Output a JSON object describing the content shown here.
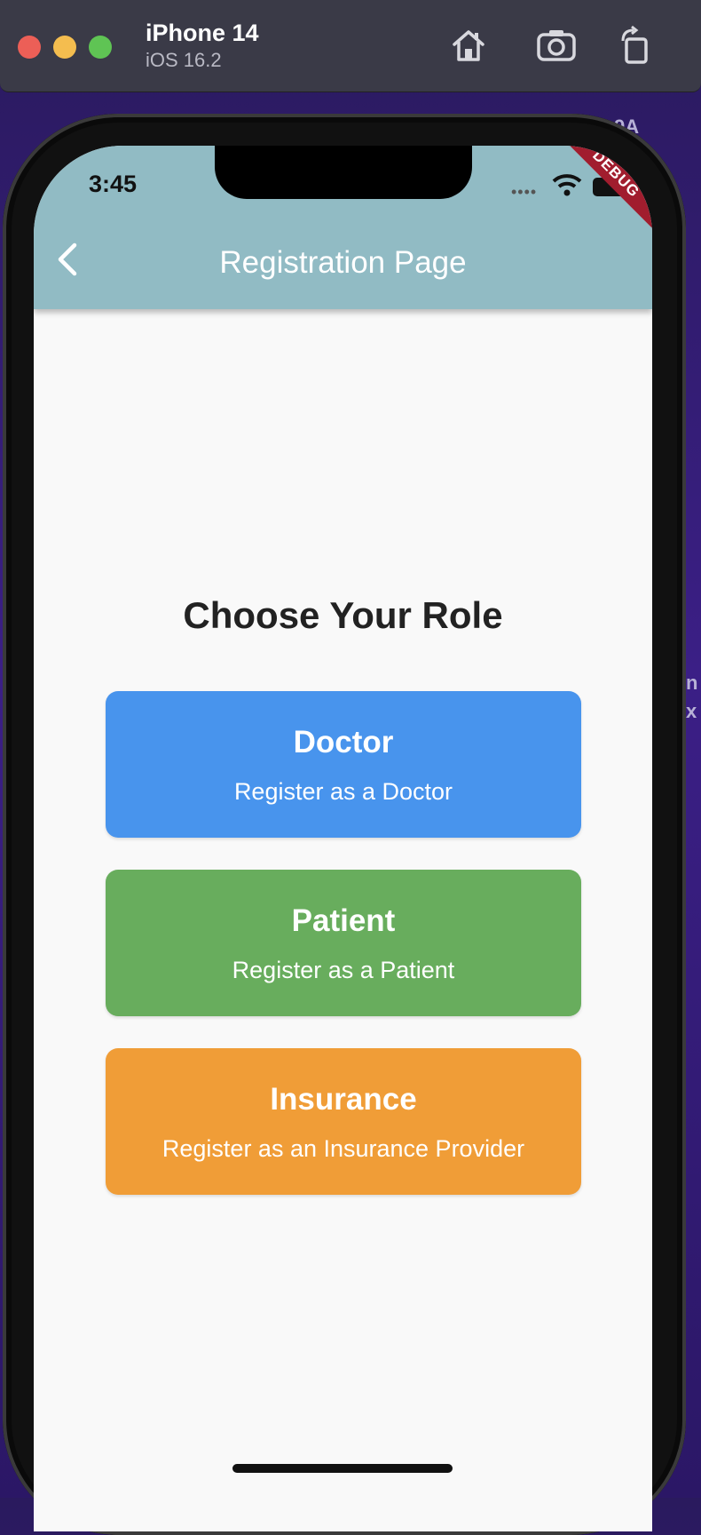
{
  "simulator": {
    "device": "iPhone 14",
    "os": "iOS 16.2",
    "icons": [
      "home-icon",
      "screenshot-icon",
      "rotate-icon"
    ]
  },
  "background_fragments": {
    "a": "9A",
    "b": "n",
    "c": "x"
  },
  "status_bar": {
    "time": "3:45",
    "icons": [
      "signal-dots-icon",
      "wifi-icon",
      "battery-icon"
    ]
  },
  "app_bar": {
    "title": "Registration Page",
    "back_icon": "chevron-left-icon",
    "color": "#91bbc4"
  },
  "debug_banner": "DEBUG",
  "content": {
    "heading": "Choose Your Role",
    "roles": [
      {
        "name": "Doctor",
        "subtitle": "Register as a Doctor",
        "color": "#4894ed"
      },
      {
        "name": "Patient",
        "subtitle": "Register as a Patient",
        "color": "#68ad5d"
      },
      {
        "name": "Insurance",
        "subtitle": "Register as an Insurance Provider",
        "color": "#f09d37"
      }
    ]
  }
}
